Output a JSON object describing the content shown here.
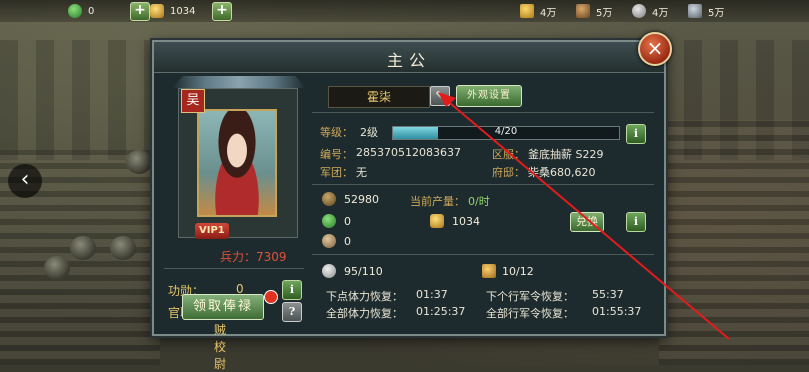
{
  "topbar": {
    "jade_value": "0",
    "gold_value": "1034",
    "res1_value": "4万",
    "res2_value": "5万",
    "res3_value": "4万",
    "res4_value": "5万"
  },
  "dialog": {
    "title": "主公",
    "close_label": "×"
  },
  "profile": {
    "tag": "吴",
    "vip": "VIP1",
    "troops_label": "兵力：",
    "troops_value": "7309",
    "merit_label": "功勋：",
    "merit_value": "0",
    "rank_label": "官职：",
    "rank_value": "破贼校尉",
    "claim_button": "领取俸禄",
    "info_icon_label": "i",
    "help_icon_label": "?"
  },
  "player": {
    "name": "霍柒",
    "edit_icon_label": "✎",
    "outfit_button": "外观设置",
    "level_label": "等级：",
    "level_value": "2级",
    "xp_text": "4/20",
    "xp_fraction": 0.2,
    "id_label": "编号：",
    "id_value": "285370512083637",
    "server_label": "区服：",
    "server_value": "釜底抽薪 S229",
    "army_label": "军团：",
    "army_value": "无",
    "mansion_label": "府邸：",
    "mansion_value": "柴桑680,620"
  },
  "resources": {
    "coins_value": "52980",
    "output_label": "当前产量：",
    "output_value": "0/时",
    "jade_value": "0",
    "gold_value": "1034",
    "token_value": "0",
    "exchange_button": "兑换"
  },
  "stamina": {
    "stamina_value": "95/110",
    "orders_value": "10/12",
    "next_stamina_label": "下点体力恢复：",
    "next_stamina_value": "01:37",
    "all_stamina_label": "全部体力恢复：",
    "all_stamina_value": "01:25:37",
    "next_order_label": "下个行军令恢复：",
    "next_order_value": "55:37",
    "all_order_label": "全部行军令恢复：",
    "all_order_value": "01:55:37"
  },
  "colors": {
    "annotation_arrow": "#e21c1c",
    "accent_gold": "#e7c66a",
    "button_green": "#3b6a30"
  }
}
